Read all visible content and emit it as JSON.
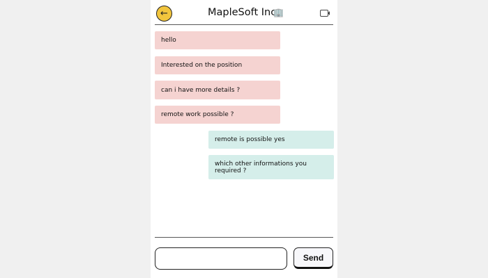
{
  "header": {
    "title": "MapleSoft Inc",
    "back_icon": "arrow-left-icon",
    "building_icon": "building-icon",
    "video_icon": "video-camera-icon",
    "accent": "#f2c53d"
  },
  "messages": [
    {
      "side": "received",
      "text": "hello"
    },
    {
      "side": "received",
      "text": "Interested on the position"
    },
    {
      "side": "received",
      "text": "can i have more details ?"
    },
    {
      "side": "received",
      "text": "remote work possible ?"
    },
    {
      "side": "sent",
      "text": "remote is possible yes"
    },
    {
      "side": "sent",
      "text": "which other informations you required ?"
    }
  ],
  "composer": {
    "input_value": "",
    "send_label": "Send"
  }
}
